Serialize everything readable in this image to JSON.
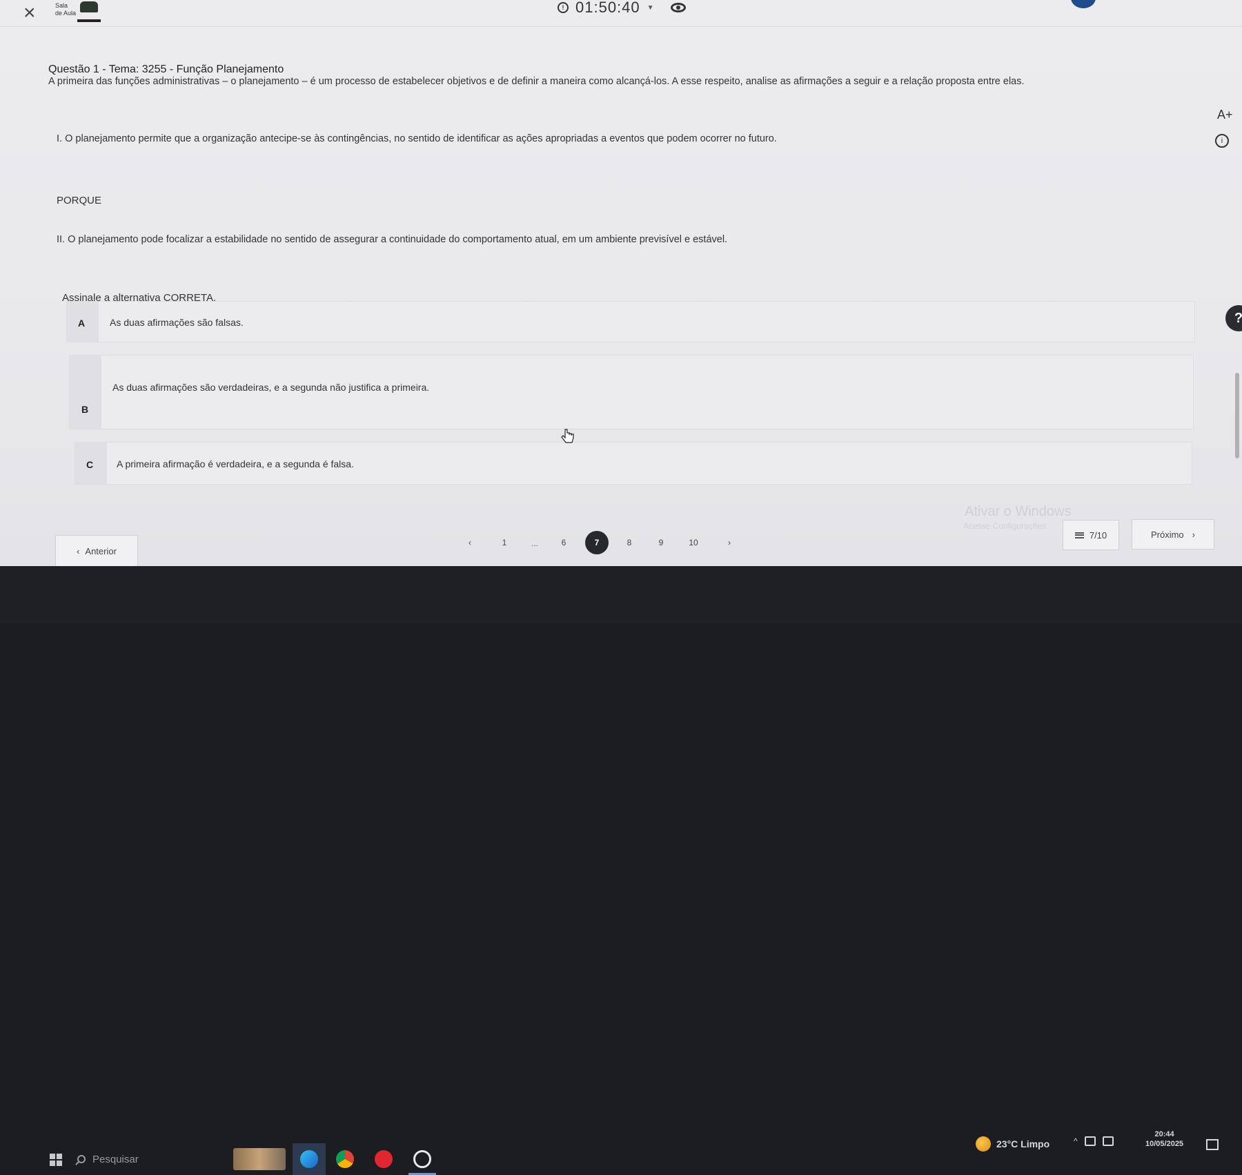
{
  "header": {
    "logo_line1": "Sala",
    "logo_line2": "de Aula",
    "timer": "01:50:40"
  },
  "question": {
    "title": "Questão 1 - Tema: 3255 - Função Planejamento",
    "intro": "A primeira das funções administrativas – o planejamento – é um processo de estabelecer objetivos e de definir a maneira como alcançá-los.  A esse respeito, analise as afirmações a seguir e a relação proposta entre elas.",
    "statement1": "I.  O planejamento permite que a organização antecipe-se às contingências, no sentido de identificar as ações apropriadas a eventos que podem ocorrer no futuro.",
    "porque": "PORQUE",
    "statement2": "II. O planejamento pode focalizar a estabilidade no sentido de assegurar a continuidade do comportamento atual, em um ambiente previsível e estável.",
    "prompt": "Assinale a alternativa CORRETA."
  },
  "options": [
    {
      "letter": "A",
      "text": "As duas afirmações são falsas."
    },
    {
      "letter": "B",
      "text": "As duas afirmações são verdadeiras, e a segunda não justifica a primeira."
    },
    {
      "letter": "C",
      "text": "A primeira afirmação é verdadeira, e a segunda é falsa."
    }
  ],
  "side": {
    "font_size_label": "A+",
    "info_label": "i",
    "help_label": "?"
  },
  "navigation": {
    "prev_label": "Anterior",
    "next_label": "Próximo",
    "prev_arrow": "‹",
    "next_arrow": "›",
    "pages": [
      "1",
      "6",
      "7",
      "8",
      "9",
      "10"
    ],
    "current_page": "7",
    "ellipsis": "...",
    "progress": "7/10"
  },
  "watermark": {
    "line1": "Ativar o Windows",
    "line2": "Acesse Configurações"
  },
  "taskbar": {
    "search_placeholder": "Pesquisar",
    "weather": "23°C  Limpo",
    "tray_chevron": "^",
    "clock_time": "20:44",
    "clock_date": "10/05/2025"
  }
}
